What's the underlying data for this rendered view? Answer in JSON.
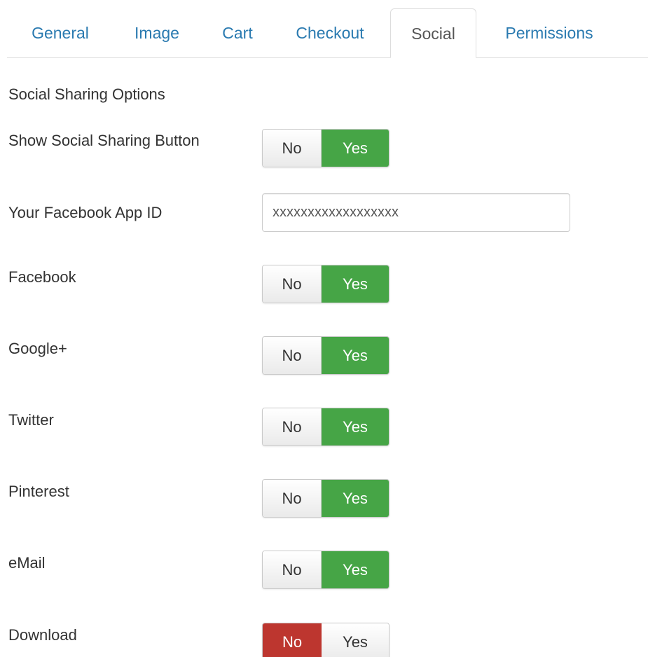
{
  "tabs": [
    {
      "label": "General",
      "active": false
    },
    {
      "label": "Image",
      "active": false
    },
    {
      "label": "Cart",
      "active": false
    },
    {
      "label": "Checkout",
      "active": false
    },
    {
      "label": "Social",
      "active": true
    },
    {
      "label": "Permissions",
      "active": false
    }
  ],
  "section": {
    "title": "Social Sharing Options"
  },
  "fields": {
    "show_social_sharing": {
      "label": "Show Social Sharing Button",
      "no": "No",
      "yes": "Yes",
      "selected": "Yes"
    },
    "facebook_app_id": {
      "label": "Your Facebook App ID",
      "value": "xxxxxxxxxxxxxxxxxx"
    },
    "facebook": {
      "label": "Facebook",
      "no": "No",
      "yes": "Yes",
      "selected": "Yes"
    },
    "google_plus": {
      "label": "Google+",
      "no": "No",
      "yes": "Yes",
      "selected": "Yes"
    },
    "twitter": {
      "label": "Twitter",
      "no": "No",
      "yes": "Yes",
      "selected": "Yes"
    },
    "pinterest": {
      "label": "Pinterest",
      "no": "No",
      "yes": "Yes",
      "selected": "Yes"
    },
    "email": {
      "label": "eMail",
      "no": "No",
      "yes": "Yes",
      "selected": "Yes"
    },
    "download": {
      "label": "Download",
      "no": "No",
      "yes": "Yes",
      "selected": "No"
    }
  },
  "colors": {
    "link": "#2a7ab0",
    "yes_active": "#46a546",
    "no_active": "#bd362f"
  }
}
